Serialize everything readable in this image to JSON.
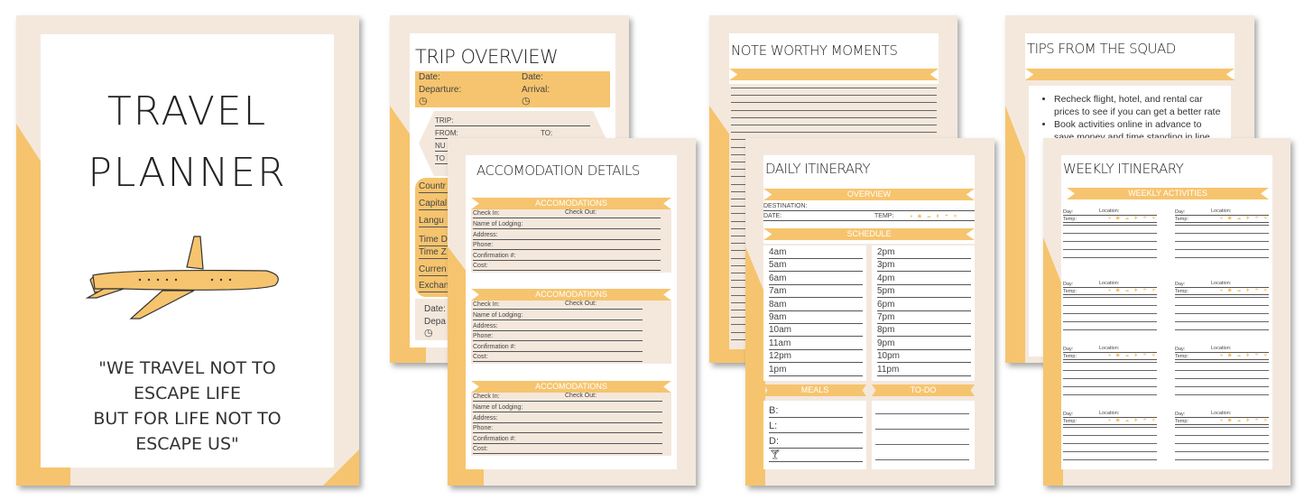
{
  "colors": {
    "accent": "#f6c46e",
    "background": "#f4e8dd"
  },
  "cover": {
    "title_line1": "TRAVEL",
    "title_line2": "PLANNER",
    "icon": "airplane-icon",
    "quote": [
      "\"WE TRAVEL NOT TO",
      "ESCAPE LIFE",
      "BUT FOR LIFE NOT TO",
      "ESCAPE US\""
    ]
  },
  "trip": {
    "title": "TRIP OVERVIEW",
    "date_left": "Date:",
    "departure": "Departure:",
    "date_right": "Date:",
    "arrival": "Arrival:",
    "trip": "TRIP:",
    "from": "FROM:",
    "to": "TO:",
    "nu": "NU",
    "to2": "TO",
    "info": [
      "Countr",
      "Capital",
      "Langu",
      "Time D",
      "Time Z",
      "Curren",
      "Exchan"
    ],
    "date_bottom": "Date:",
    "dep_bottom": "Depa"
  },
  "accom": {
    "title": "ACCOMODATION DETAILS",
    "banner": "ACCOMODATIONS",
    "check_in": "Check In:",
    "check_out": "Check Out:",
    "fields": [
      "Name of Lodging:",
      "Address:",
      "Phone:",
      "Confirmation #:",
      "Cost:"
    ]
  },
  "notes": {
    "title": "NOTE WORTHY MOMENTS"
  },
  "daily": {
    "title": "DAILY ITINERARY",
    "overview": "OVERVIEW",
    "destination": "DESTINATION:",
    "date": "DATE:",
    "temp": "TEMP:",
    "schedule": "SCHEDULE",
    "times_left": [
      "4am",
      "5am",
      "6am",
      "7am",
      "8am",
      "9am",
      "10am",
      "11am",
      "12pm",
      "1pm"
    ],
    "times_right": [
      "2pm",
      "3pm",
      "4pm",
      "5pm",
      "6pm",
      "7pm",
      "8pm",
      "9pm",
      "10pm",
      "11pm"
    ],
    "meals": "MEALS",
    "todo": "TO-DO",
    "meal_labels": [
      "B:",
      "L:",
      "D:"
    ]
  },
  "tips": {
    "title": "TIPS FROM THE SQUAD",
    "bullets": [
      "Recheck flight, hotel, and rental car prices to see if you can get a better rate",
      "Book activities online in advance to save money and time standing in line while"
    ]
  },
  "weekly": {
    "title": "WEEKLY ITINERARY",
    "banner": "WEEKLY ACTIVITIES",
    "day": "Day:",
    "location": "Location:",
    "temp": "Temp:",
    "weather_icons": "● ☗ ☁ ❥ ☂ ❄"
  }
}
